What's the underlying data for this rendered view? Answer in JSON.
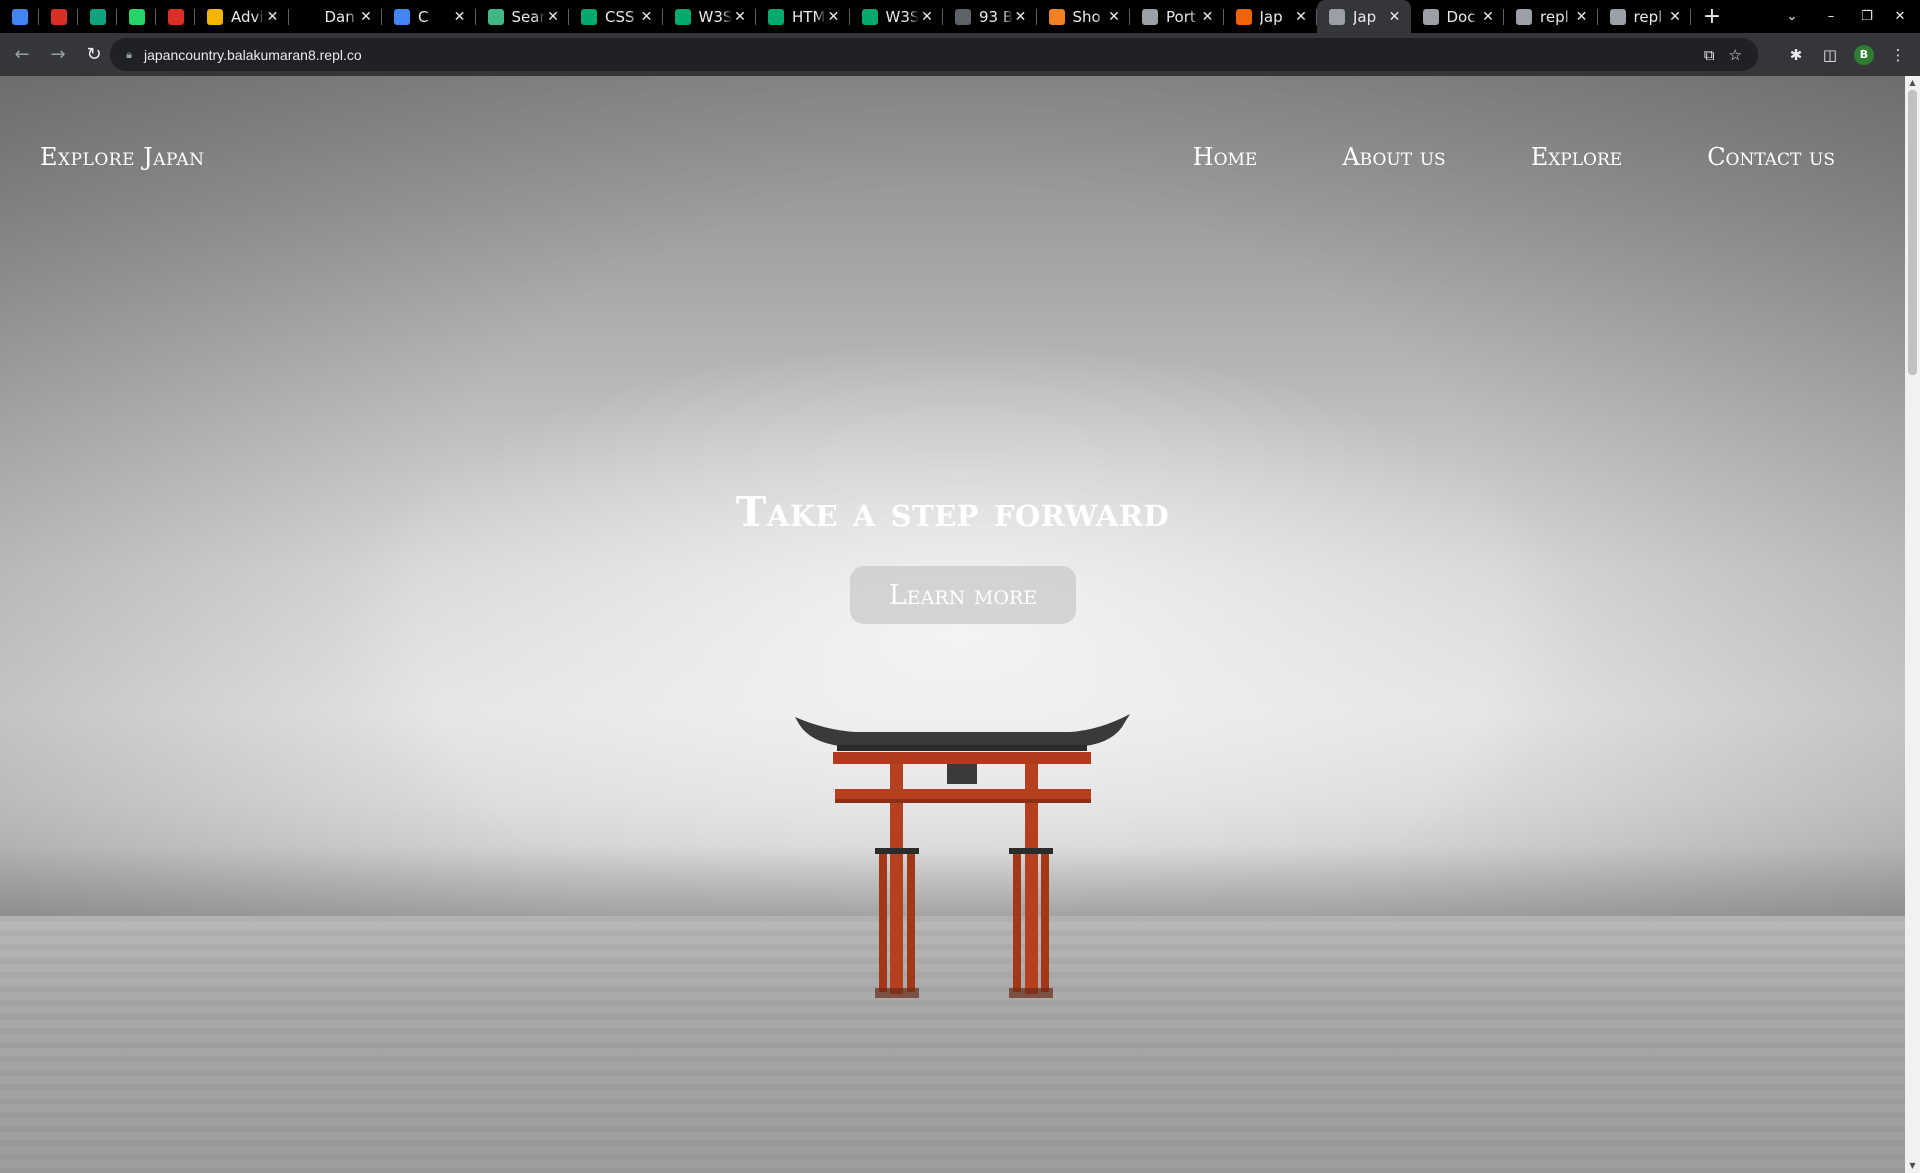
{
  "browser": {
    "tabs": [
      {
        "title": "",
        "icon": "chat-icon",
        "pinned": true,
        "color": "#4285f4"
      },
      {
        "title": "",
        "icon": "shield-icon",
        "pinned": true,
        "color": "#d93025"
      },
      {
        "title": "",
        "icon": "chatgpt-icon",
        "pinned": true,
        "color": "#10a37f"
      },
      {
        "title": "",
        "icon": "whatsapp-icon",
        "pinned": true,
        "color": "#25d366"
      },
      {
        "title": "",
        "icon": "shield-icon",
        "pinned": true,
        "color": "#d93025"
      },
      {
        "title": "Advi",
        "icon": "hand-icon",
        "color": "#f4b400"
      },
      {
        "title": "Dan",
        "icon": "h-icon",
        "color": "#000000"
      },
      {
        "title": "C",
        "icon": "chat-icon",
        "color": "#4285f4"
      },
      {
        "title": "Sear",
        "icon": "vue-icon",
        "color": "#41b883"
      },
      {
        "title": "CSS",
        "icon": "w3schools-icon",
        "color": "#04aa6d"
      },
      {
        "title": "W3S",
        "icon": "w3schools-icon",
        "color": "#04aa6d"
      },
      {
        "title": "HTM",
        "icon": "w3schools-icon",
        "color": "#04aa6d"
      },
      {
        "title": "W3S",
        "icon": "w3schools-icon",
        "color": "#04aa6d"
      },
      {
        "title": "93 B",
        "icon": "bookmark-icon",
        "color": "#5f6368"
      },
      {
        "title": "Sho",
        "icon": "stackoverflow-icon",
        "color": "#f48024"
      },
      {
        "title": "Port",
        "icon": "globe-icon",
        "color": "#9aa0a6"
      },
      {
        "title": "Jap",
        "icon": "replit-icon",
        "color": "#f26207"
      },
      {
        "title": "Jap",
        "icon": "globe-icon",
        "color": "#9aa0a6",
        "active": true
      },
      {
        "title": "Doc",
        "icon": "globe-icon",
        "color": "#9aa0a6"
      },
      {
        "title": "repl",
        "icon": "globe-icon",
        "color": "#9aa0a6"
      },
      {
        "title": "repl",
        "icon": "globe-icon",
        "color": "#9aa0a6"
      }
    ],
    "url": "japancountry.balakumaran8.repl.co",
    "profile_initial": "B"
  },
  "site": {
    "logo": "Explore Japan",
    "nav": [
      "Home",
      "About us",
      "Explore",
      "Contact us"
    ],
    "hero_title": "Take a step forward",
    "hero_button": "Learn more"
  }
}
